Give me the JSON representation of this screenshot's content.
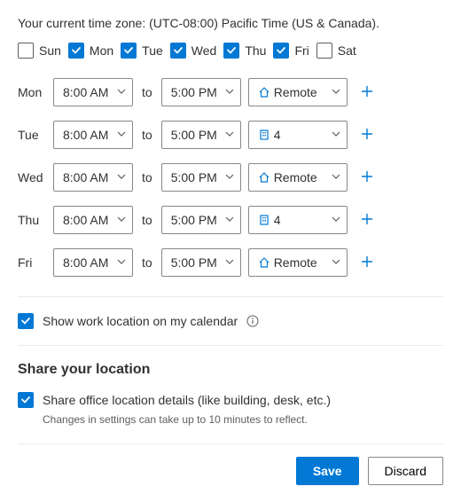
{
  "timezone_text": "Your current time zone: (UTC-08:00) Pacific Time (US & Canada).",
  "days": [
    {
      "abbr": "Sun",
      "checked": false
    },
    {
      "abbr": "Mon",
      "checked": true
    },
    {
      "abbr": "Tue",
      "checked": true
    },
    {
      "abbr": "Wed",
      "checked": true
    },
    {
      "abbr": "Thu",
      "checked": true
    },
    {
      "abbr": "Fri",
      "checked": true
    },
    {
      "abbr": "Sat",
      "checked": false
    }
  ],
  "to_label": "to",
  "schedule": [
    {
      "day": "Mon",
      "start": "8:00 AM",
      "end": "5:00 PM",
      "location": "Remote",
      "loc_type": "home"
    },
    {
      "day": "Tue",
      "start": "8:00 AM",
      "end": "5:00 PM",
      "location": "4",
      "loc_type": "building"
    },
    {
      "day": "Wed",
      "start": "8:00 AM",
      "end": "5:00 PM",
      "location": "Remote",
      "loc_type": "home"
    },
    {
      "day": "Thu",
      "start": "8:00 AM",
      "end": "5:00 PM",
      "location": "4",
      "loc_type": "building"
    },
    {
      "day": "Fri",
      "start": "8:00 AM",
      "end": "5:00 PM",
      "location": "Remote",
      "loc_type": "home"
    }
  ],
  "show_location_label": "Show work location on my calendar",
  "show_location_checked": true,
  "share_section_title": "Share your location",
  "share_details_label": "Share office location details (like building, desk, etc.)",
  "share_details_checked": true,
  "share_helper": "Changes in settings can take up to 10 minutes to reflect.",
  "save_label": "Save",
  "discard_label": "Discard"
}
